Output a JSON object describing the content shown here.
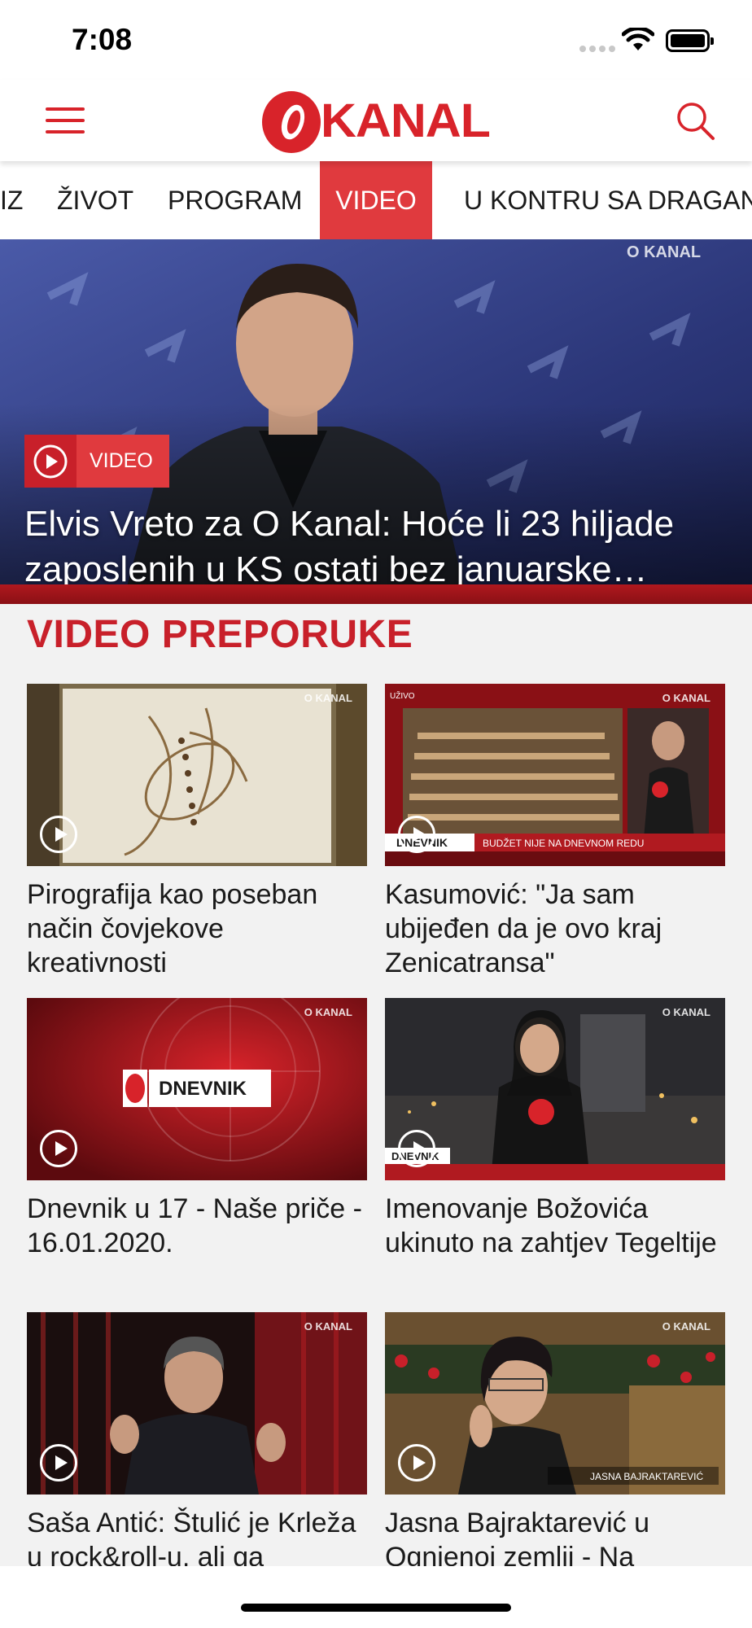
{
  "status_bar": {
    "time": "7:08"
  },
  "header": {
    "logo_text": "KANAL",
    "brand_color": "#d8232a"
  },
  "tabs": [
    {
      "label": "IZ"
    },
    {
      "label": "ŽIVOT"
    },
    {
      "label": "PROGRAM"
    },
    {
      "label": "VIDEO",
      "active": true
    },
    {
      "label": "U KONTRU SA DRAGAN"
    }
  ],
  "hero": {
    "badge": "VIDEO",
    "title_line1": "Elvis Vreto za O Kanal: Hoće li 23 hiljade",
    "title_line2": "zaposlenih u KS ostati bez januarske…"
  },
  "section": {
    "title": "VIDEO PREPORUKE"
  },
  "videos": [
    {
      "title": "Pirografija kao poseban način čovjekove kreativnosti"
    },
    {
      "title": "Kasumović: \"Ja sam ubijeđen da je ovo kraj Zenicatransa\""
    },
    {
      "title": "Dnevnik u 17 - Naše priče - 16.01.2020."
    },
    {
      "title": "Imenovanje Božovića ukinuto na zahtjev Tegeltije"
    },
    {
      "title": "Saša Antić: Štulić je Krleža u rock&roll-u, ali ga"
    },
    {
      "title": "Jasna Bajraktarević u Ognjenoj zemlji - Na"
    }
  ],
  "thumb_text": {
    "dnevnik_label": "DNEVNIK",
    "ticker1": "BUDŽET NIJE NA DNEVNOM REDU",
    "lower_third_jasna": "JASNA BAJRAKTAREVIĆ"
  },
  "icons": [
    "menu-icon",
    "search-icon",
    "play-icon",
    "wifi-icon",
    "battery-icon"
  ]
}
